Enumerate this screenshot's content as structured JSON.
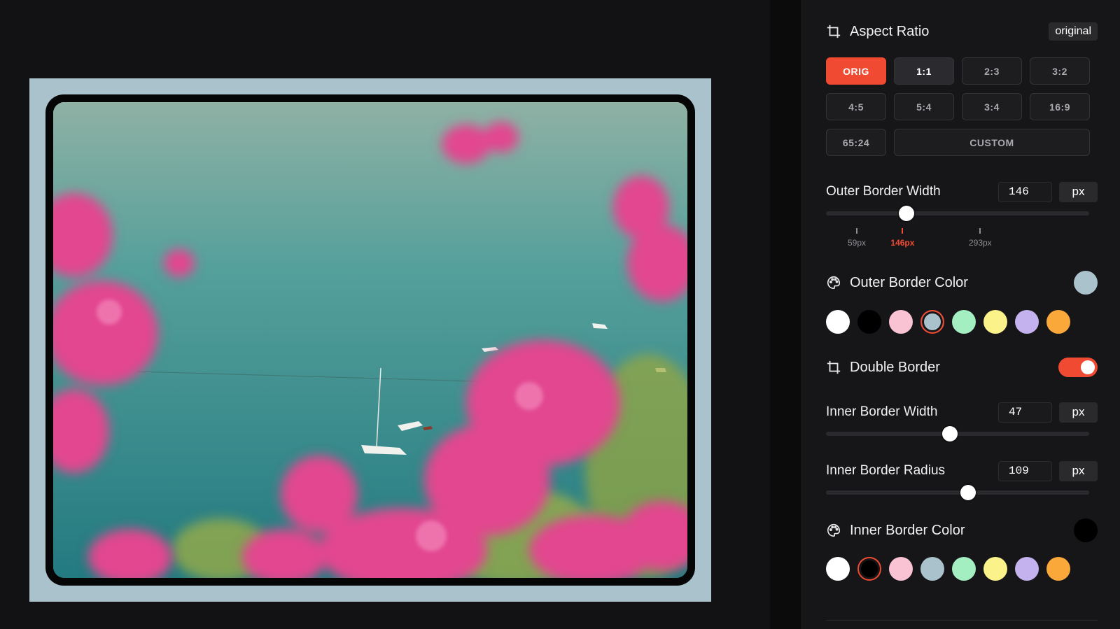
{
  "aspect_ratio": {
    "title": "Aspect Ratio",
    "badge": "original",
    "options": [
      {
        "label": "ORIG",
        "state": "active"
      },
      {
        "label": "1:1",
        "state": "hover"
      },
      {
        "label": "2:3",
        "state": "normal"
      },
      {
        "label": "3:2",
        "state": "normal"
      },
      {
        "label": "4:5",
        "state": "normal"
      },
      {
        "label": "5:4",
        "state": "normal"
      },
      {
        "label": "3:4",
        "state": "normal"
      },
      {
        "label": "16:9",
        "state": "normal"
      },
      {
        "label": "65:24",
        "state": "normal"
      },
      {
        "label": "CUSTOM",
        "state": "normal"
      }
    ]
  },
  "outer_border_width": {
    "label": "Outer Border Width",
    "value": "146",
    "unit": "px",
    "slider_fraction": 0.305,
    "ticks": [
      {
        "label": "59px",
        "fraction": 0.117,
        "active": false
      },
      {
        "label": "146px",
        "fraction": 0.291,
        "active": true
      },
      {
        "label": "293px",
        "fraction": 0.586,
        "active": false
      }
    ]
  },
  "outer_border_color": {
    "label": "Outer Border Color",
    "current": "#a9c2cc",
    "swatches": [
      "#ffffff",
      "#000000",
      "#f9c3d3",
      "#a9c2cc",
      "#a3efc1",
      "#fbf38a",
      "#c4b2ef",
      "#fba83b"
    ],
    "selected_index": 3
  },
  "double_border": {
    "label": "Double Border",
    "enabled": true
  },
  "inner_border_width": {
    "label": "Inner Border Width",
    "value": "47",
    "unit": "px",
    "slider_fraction": 0.47
  },
  "inner_border_radius": {
    "label": "Inner Border Radius",
    "value": "109",
    "unit": "px",
    "slider_fraction": 0.54
  },
  "inner_border_color": {
    "label": "Inner Border Color",
    "current": "#000000",
    "swatches": [
      "#ffffff",
      "#000000",
      "#f9c3d3",
      "#a9c2cc",
      "#a3efc1",
      "#fbf38a",
      "#c4b2ef",
      "#fba83b"
    ],
    "selected_index": 1
  },
  "accent_color": "#f14a33"
}
